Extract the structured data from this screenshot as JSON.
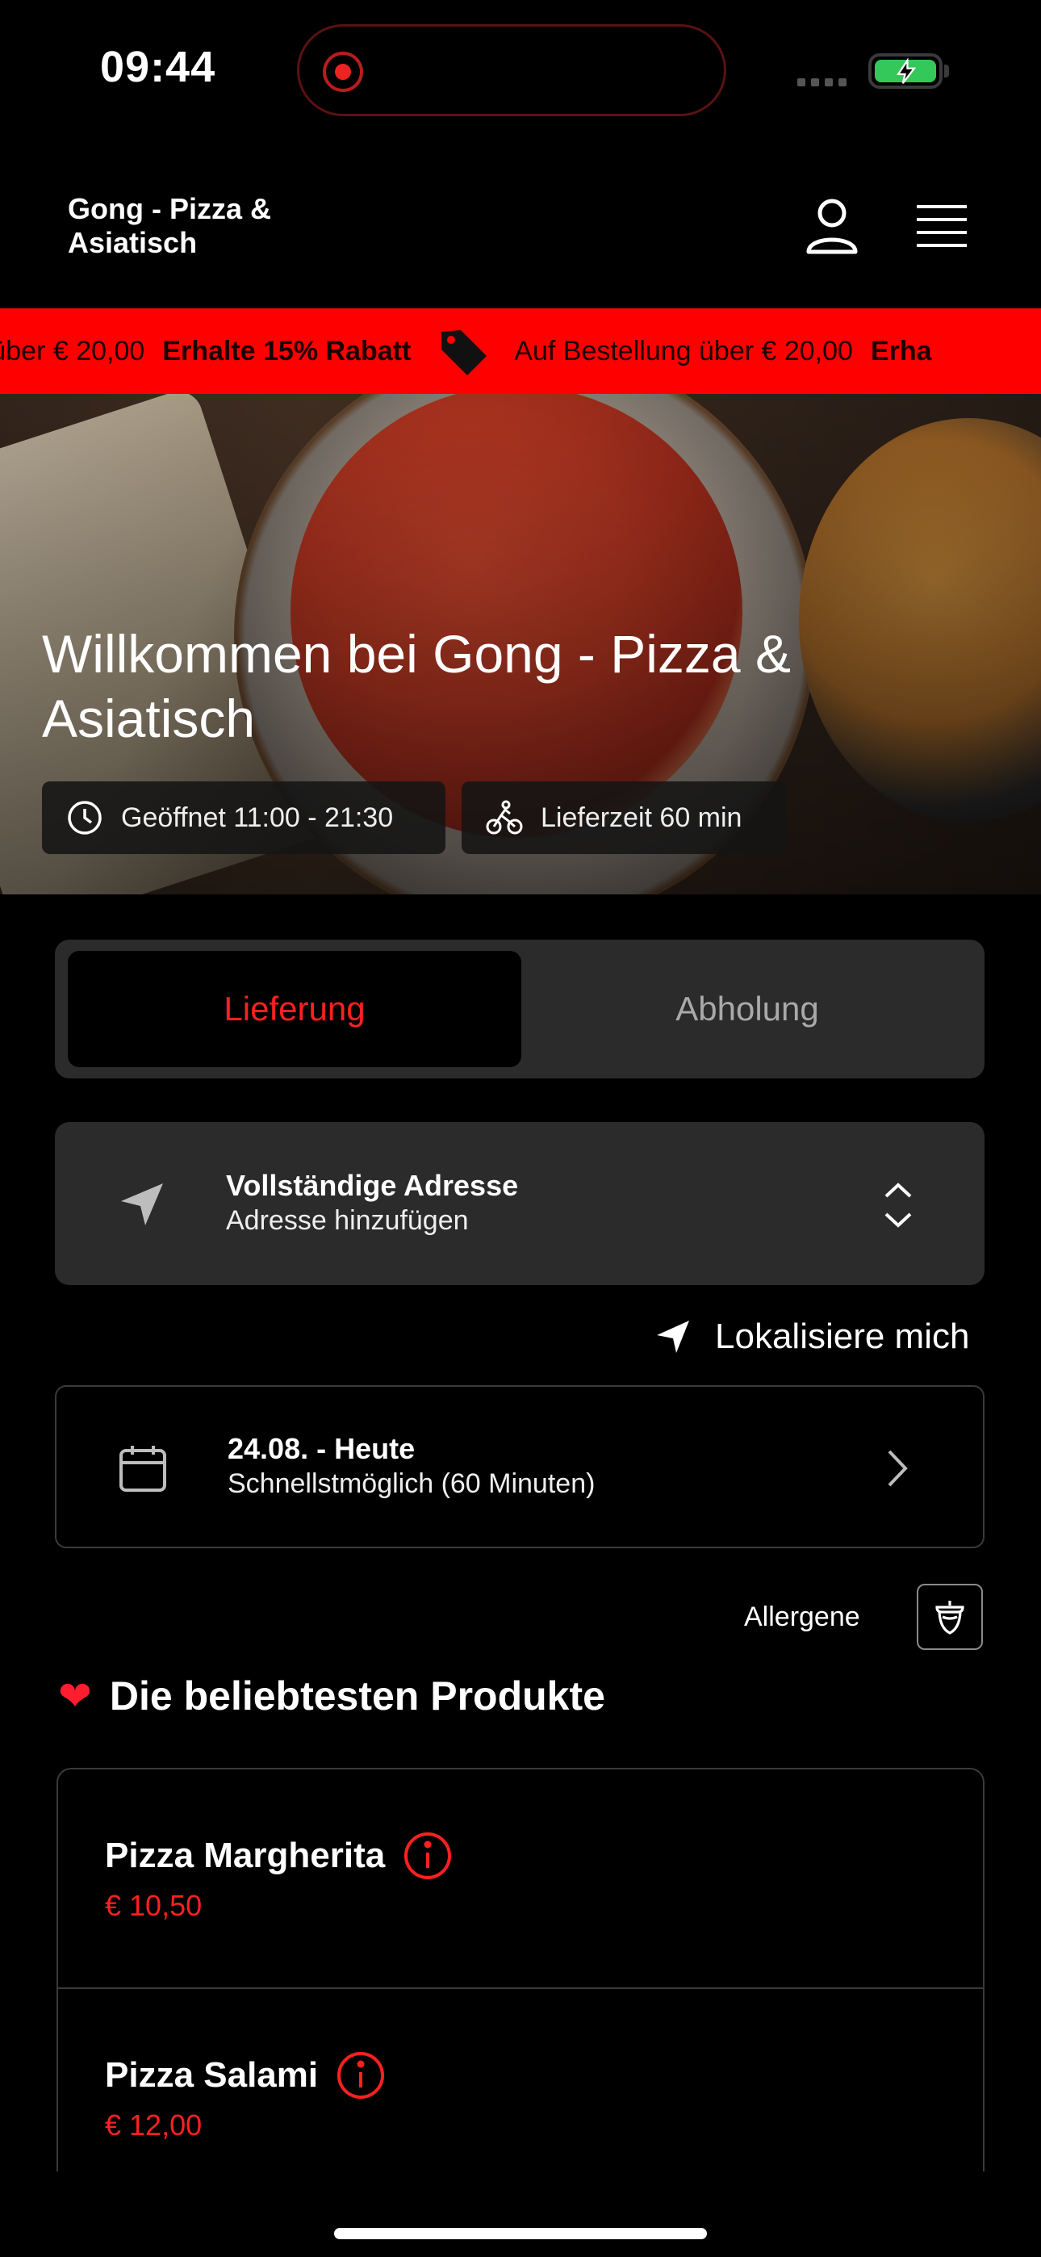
{
  "status_bar": {
    "time": "09:44"
  },
  "header": {
    "brand": "Gong - Pizza & Asiatisch"
  },
  "promo": {
    "items": [
      {
        "text": "Auf Bestellung über € 20,00",
        "highlight": "Erhalte 15% Rabatt"
      }
    ],
    "visible_start": "g über € 20,00",
    "visible_highlight_1": "Erhalte 15% Rabatt",
    "visible_text_2": "Auf Bestellung über € 20,00",
    "visible_highlight_2": "Erha"
  },
  "hero": {
    "title": "Willkommen bei Gong - Pizza & Asiatisch",
    "open_hours": "Geöffnet 11:00 - 21:30",
    "delivery_time": "Lieferzeit 60 min"
  },
  "order_mode": {
    "options": [
      "Lieferung",
      "Abholung"
    ],
    "selected": "Lieferung"
  },
  "address": {
    "title": "Vollständige Adresse",
    "subtitle": "Adresse hinzufügen",
    "locate_label": "Lokalisiere mich"
  },
  "schedule": {
    "date": "24.08. - Heute",
    "time": "Schnellstmöglich (60 Minuten)"
  },
  "allergens": {
    "label": "Allergene"
  },
  "popular": {
    "title": "Die beliebtesten Produkte",
    "products": [
      {
        "name": "Pizza Margherita",
        "price": "€ 10,50"
      },
      {
        "name": "Pizza Salami",
        "price": "€ 12,00"
      }
    ]
  },
  "colors": {
    "accent": "#ff2020",
    "promo_bg": "#ff0000",
    "card_bg": "#2b2b2b"
  }
}
